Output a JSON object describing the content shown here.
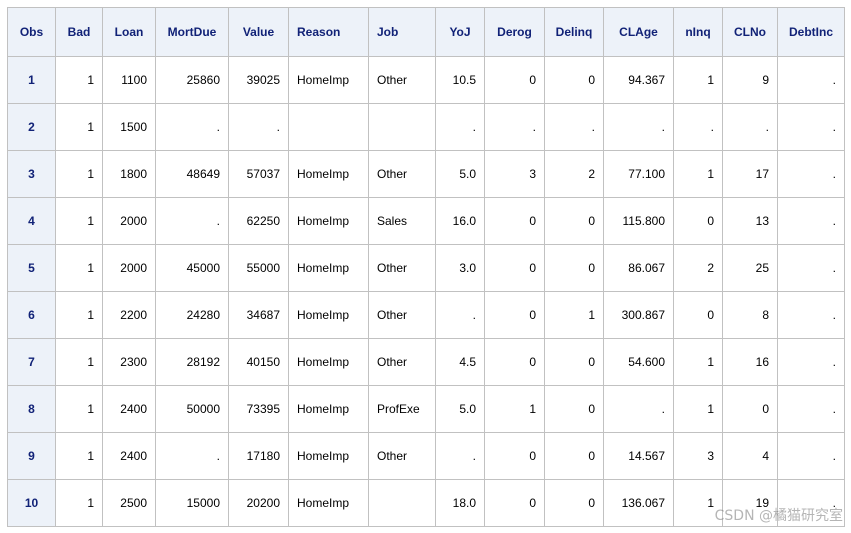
{
  "table": {
    "columns": [
      {
        "label": "Obs",
        "align": "c"
      },
      {
        "label": "Bad",
        "align": "c"
      },
      {
        "label": "Loan",
        "align": "c"
      },
      {
        "label": "MortDue",
        "align": "c"
      },
      {
        "label": "Value",
        "align": "c"
      },
      {
        "label": "Reason",
        "align": "l"
      },
      {
        "label": "Job",
        "align": "l"
      },
      {
        "label": "YoJ",
        "align": "c"
      },
      {
        "label": "Derog",
        "align": "c"
      },
      {
        "label": "Delinq",
        "align": "c"
      },
      {
        "label": "CLAge",
        "align": "c"
      },
      {
        "label": "nInq",
        "align": "c"
      },
      {
        "label": "CLNo",
        "align": "c"
      },
      {
        "label": "DebtInc",
        "align": "c"
      }
    ],
    "rows": [
      [
        "1",
        "1",
        "1100",
        "25860",
        "39025",
        "HomeImp",
        "Other",
        "10.5",
        "0",
        "0",
        "94.367",
        "1",
        "9",
        "."
      ],
      [
        "2",
        "1",
        "1500",
        ".",
        ".",
        "",
        "",
        ".",
        ".",
        ".",
        ".",
        ".",
        ".",
        "."
      ],
      [
        "3",
        "1",
        "1800",
        "48649",
        "57037",
        "HomeImp",
        "Other",
        "5.0",
        "3",
        "2",
        "77.100",
        "1",
        "17",
        "."
      ],
      [
        "4",
        "1",
        "2000",
        ".",
        "62250",
        "HomeImp",
        "Sales",
        "16.0",
        "0",
        "0",
        "115.800",
        "0",
        "13",
        "."
      ],
      [
        "5",
        "1",
        "2000",
        "45000",
        "55000",
        "HomeImp",
        "Other",
        "3.0",
        "0",
        "0",
        "86.067",
        "2",
        "25",
        "."
      ],
      [
        "6",
        "1",
        "2200",
        "24280",
        "34687",
        "HomeImp",
        "Other",
        ".",
        "0",
        "1",
        "300.867",
        "0",
        "8",
        "."
      ],
      [
        "7",
        "1",
        "2300",
        "28192",
        "40150",
        "HomeImp",
        "Other",
        "4.5",
        "0",
        "0",
        "54.600",
        "1",
        "16",
        "."
      ],
      [
        "8",
        "1",
        "2400",
        "50000",
        "73395",
        "HomeImp",
        "ProfExe",
        "5.0",
        "1",
        "0",
        ".",
        "1",
        "0",
        "."
      ],
      [
        "9",
        "1",
        "2400",
        ".",
        "17180",
        "HomeImp",
        "Other",
        ".",
        "0",
        "0",
        "14.567",
        "3",
        "4",
        "."
      ],
      [
        "10",
        "1",
        "2500",
        "15000",
        "20200",
        "HomeImp",
        "",
        "18.0",
        "0",
        "0",
        "136.067",
        "1",
        "19",
        "."
      ]
    ]
  },
  "watermark": "CSDN @橘猫研究室"
}
